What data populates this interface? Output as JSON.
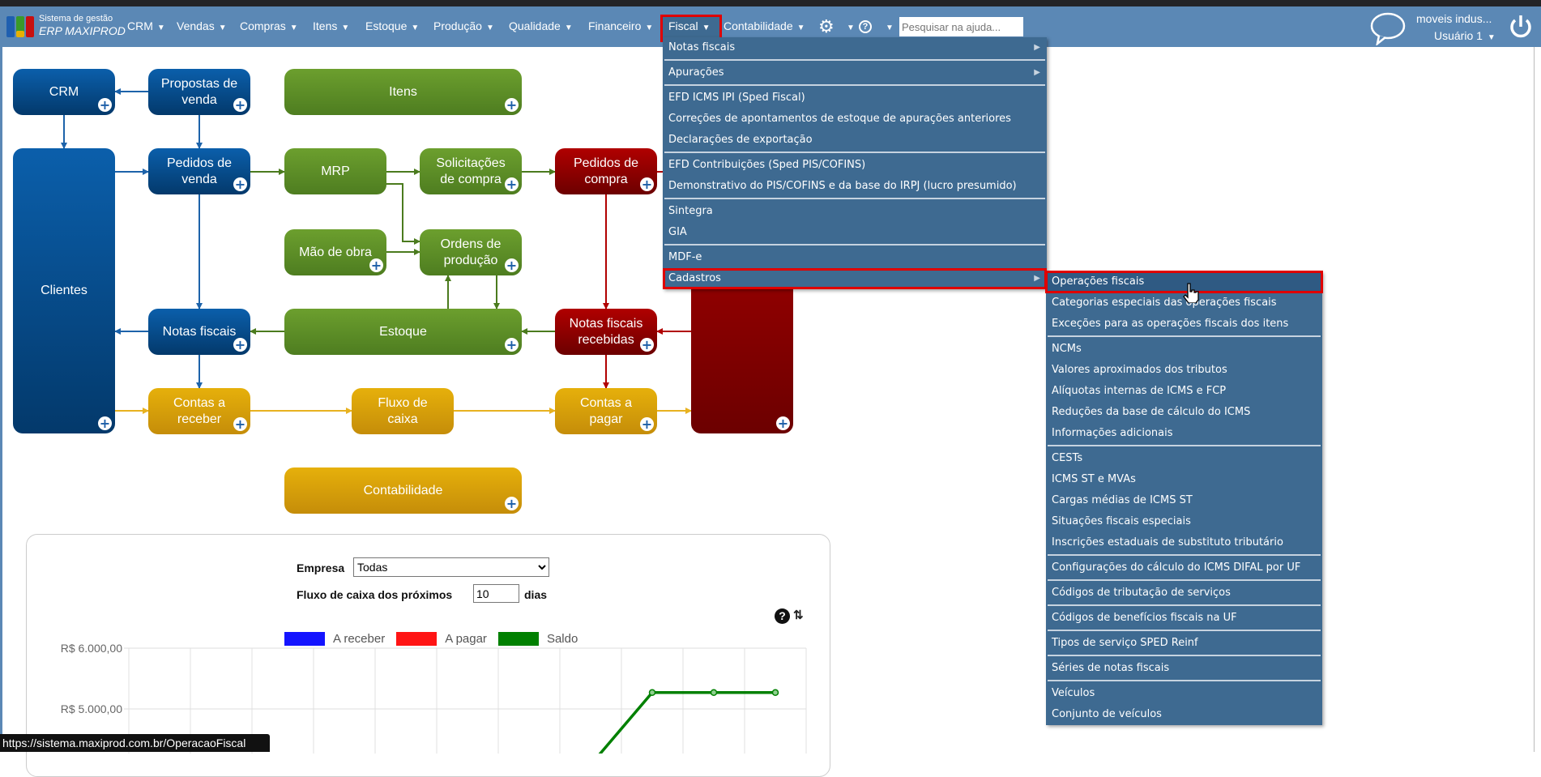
{
  "logo": {
    "line1": "Sistema de gestão",
    "line2": "ERP MAXIPROD"
  },
  "nav": {
    "items": [
      "CRM",
      "Vendas",
      "Compras",
      "Itens",
      "Estoque",
      "Produção",
      "Qualidade",
      "Financeiro",
      "Fiscal",
      "Contabilidade"
    ],
    "search_placeholder": "Pesquisar na ajuda...",
    "company": "moveis indus...",
    "user": "Usuário 1",
    "icons": [
      "gear-icon",
      "help-icon",
      "chat-icon",
      "power-icon"
    ]
  },
  "flow": {
    "crm": "CRM",
    "propostas": "Propostas de venda",
    "itens": "Itens",
    "clientes": "Clientes",
    "pedidos_venda": "Pedidos de venda",
    "mrp": "MRP",
    "solicitacoes": "Solicitações de compra",
    "pedidos_compra": "Pedidos de compra",
    "mao_obra": "Mão de obra",
    "ordens": "Ordens de produção",
    "notas": "Notas fiscais",
    "estoque": "Estoque",
    "nf_recebidas": "Notas fiscais recebidas",
    "contas_receber": "Contas a receber",
    "fluxo": "Fluxo de caixa",
    "contas_pagar": "Contas a pagar",
    "contabilidade": "Contabilidade"
  },
  "fiscal_menu": {
    "items": [
      {
        "label": "Notas fiscais",
        "submenu": true
      },
      {
        "sep": true
      },
      {
        "label": "Apurações",
        "submenu": true
      },
      {
        "sep": true
      },
      {
        "label": "EFD ICMS IPI (Sped Fiscal)"
      },
      {
        "label": "Correções de apontamentos de estoque de apurações anteriores"
      },
      {
        "label": "Declarações de exportação"
      },
      {
        "sep": true
      },
      {
        "label": "EFD Contribuições (Sped PIS/COFINS)"
      },
      {
        "label": "Demonstrativo do PIS/COFINS e da base do IRPJ (lucro presumido)"
      },
      {
        "sep": true
      },
      {
        "label": "Sintegra"
      },
      {
        "label": "GIA"
      },
      {
        "sep": true
      },
      {
        "label": "MDF-e"
      },
      {
        "label": "Cadastros",
        "submenu": true,
        "highlighted": true
      }
    ]
  },
  "cadastros_menu": {
    "items": [
      {
        "label": "Operações fiscais",
        "highlighted": true
      },
      {
        "label": "Categorias especiais das operações fiscais"
      },
      {
        "label": "Exceções para as operações fiscais dos itens"
      },
      {
        "sep": true
      },
      {
        "label": "NCMs"
      },
      {
        "label": "Valores aproximados dos tributos"
      },
      {
        "label": "Alíquotas internas de ICMS e FCP"
      },
      {
        "label": "Reduções da base de cálculo do ICMS"
      },
      {
        "label": "Informações adicionais"
      },
      {
        "sep": true
      },
      {
        "label": "CESTs"
      },
      {
        "label": "ICMS ST e MVAs"
      },
      {
        "label": "Cargas médias de ICMS ST"
      },
      {
        "label": "Situações fiscais especiais"
      },
      {
        "label": "Inscrições estaduais de substituto tributário"
      },
      {
        "sep": true
      },
      {
        "label": "Configurações do cálculo do ICMS DIFAL por UF"
      },
      {
        "sep": true
      },
      {
        "label": "Códigos de tributação de serviços"
      },
      {
        "sep": true
      },
      {
        "label": "Códigos de benefícios fiscais na UF"
      },
      {
        "sep": true
      },
      {
        "label": "Tipos de serviço SPED Reinf"
      },
      {
        "sep": true
      },
      {
        "label": "Séries de notas fiscais"
      },
      {
        "sep": true
      },
      {
        "label": "Veículos"
      },
      {
        "label": "Conjunto de veículos"
      }
    ]
  },
  "cashflow": {
    "empresa_label": "Empresa",
    "empresa_value": "Todas",
    "fluxo_label": "Fluxo de caixa dos próximos",
    "dias_value": "10",
    "dias_label": "dias"
  },
  "chart_data": {
    "type": "line",
    "series": [
      {
        "name": "A receber",
        "color": "#1414ff",
        "values": []
      },
      {
        "name": "A pagar",
        "color": "#ff1414",
        "values": []
      },
      {
        "name": "Saldo",
        "color": "#008000",
        "values": [
          null,
          null,
          null,
          null,
          null,
          null,
          null,
          4080,
          5270,
          5270,
          5270
        ]
      }
    ],
    "yticks": [
      "R$ 6.000,00",
      "R$ 5.000,00"
    ],
    "ytick_values": [
      6000,
      5000
    ],
    "n_categories": 11,
    "legend": "top",
    "grid": true
  },
  "status_url": "https://sistema.maxiprod.com.br/OperacaoFiscal"
}
